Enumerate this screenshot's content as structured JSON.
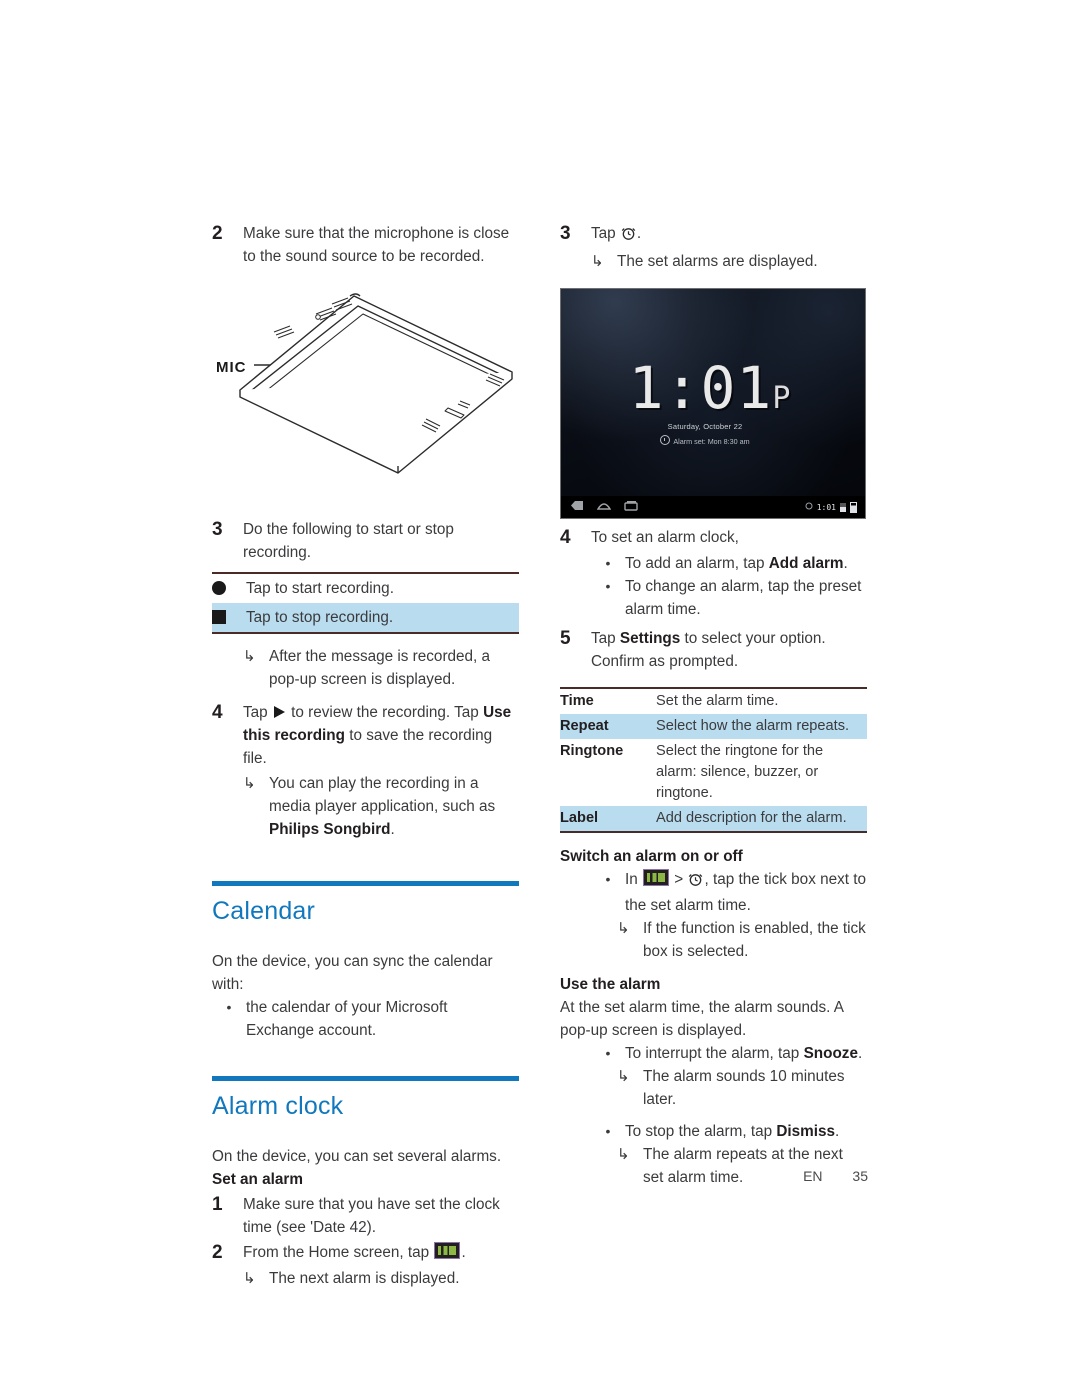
{
  "page": {
    "language_code": "EN",
    "page_number": "35"
  },
  "colors": {
    "heading_blue": "#1178bd",
    "row_highlight": "#b9dcef",
    "rule_dark": "#4a2b27",
    "body_text": "#3b3b3d"
  },
  "left_column": {
    "step2": {
      "number": "2",
      "text": "Make sure that the microphone is close to the sound source to be recorded."
    },
    "figure": {
      "label": "MIC",
      "caption_alt": "tablet illustration with microphone callout"
    },
    "step3": {
      "number": "3",
      "text": "Do the following to start or stop recording."
    },
    "record_table": {
      "rows": [
        {
          "icon": "record-circle-icon",
          "text": "Tap to start recording.",
          "highlight": false
        },
        {
          "icon": "stop-square-icon",
          "text": "Tap to stop recording.",
          "highlight": true
        }
      ]
    },
    "step3_result": "After the message is recorded, a pop-up screen is displayed.",
    "step4": {
      "number": "4",
      "text_before": "Tap",
      "icon": "play-icon",
      "text_middle": "to review the recording. Tap",
      "bold1": "Use this recording",
      "text_after": "to save the recording file."
    },
    "step4_result": {
      "text_before": "You can play the recording in a media player application, such as",
      "bold": "Philips Songbird",
      "text_after": "."
    },
    "calendar_section": {
      "title": "Calendar",
      "intro": "On the device, you can sync the calendar with:",
      "bullets": [
        "the calendar of your Microsoft Exchange account."
      ]
    },
    "alarm_section": {
      "title": "Alarm clock",
      "intro": "On the device, you can set several alarms.",
      "subhead": "Set an alarm",
      "step1": {
        "number": "1",
        "text": "Make sure that you have set the clock time (see 'Date 42)."
      },
      "step2": {
        "number": "2",
        "text_before": "From the Home screen, tap",
        "icon": "clock-app-icon",
        "text_after": "."
      },
      "step2_result": "The next alarm is displayed."
    }
  },
  "right_column": {
    "step3": {
      "number": "3",
      "text_before": "Tap",
      "icon": "alarm-clock-icon",
      "text_after": ".",
      "result": "The set alarms are displayed."
    },
    "screenshot": {
      "name": "android-clock-screenshot",
      "time": "1:01",
      "ampm": "P",
      "date": "Saturday, October 22",
      "alarm_status": "Alarm set: Mon 8:30 am",
      "statusbar_time": "1:01",
      "nav_icons": [
        "back-icon",
        "home-icon",
        "recents-icon"
      ],
      "status_icons": [
        "sync-icon",
        "wifi-icon",
        "battery-icon"
      ]
    },
    "step4": {
      "number": "4",
      "text": "To set an alarm clock,",
      "bullets": [
        {
          "text_before": "To add an alarm, tap",
          "bold": "Add alarm",
          "text_after": "."
        },
        {
          "text_before": "To change an alarm, tap the preset alarm time.",
          "bold": "",
          "text_after": ""
        }
      ]
    },
    "step5": {
      "number": "5",
      "text_before": "Tap",
      "bold": "Settings",
      "text_after": "to select your option. Confirm as prompted."
    },
    "settings_table": {
      "rows": [
        {
          "label": "Time",
          "desc": "Set the alarm time.",
          "highlight": false
        },
        {
          "label": "Repeat",
          "desc": "Select how the alarm repeats.",
          "highlight": true
        },
        {
          "label": "Ringtone",
          "desc": "Select the ringtone for the alarm: silence, buzzer, or ringtone.",
          "highlight": false
        },
        {
          "label": "Label",
          "desc": "Add description for the alarm.",
          "highlight": true
        }
      ]
    },
    "switch_section": {
      "subhead": "Switch an alarm on or off",
      "bullet_before": "In",
      "icon1": "clock-app-icon",
      "separator": ">",
      "icon2": "alarm-clock-icon",
      "bullet_after": ", tap the tick box next to the set alarm time.",
      "result": "If the function is enabled, the tick box is selected."
    },
    "use_section": {
      "subhead": "Use the alarm",
      "intro": "At the set alarm time, the alarm sounds. A pop-up screen is displayed.",
      "items": [
        {
          "text_before": "To interrupt the alarm, tap",
          "bold": "Snooze",
          "text_after": ".",
          "result": "The alarm sounds 10 minutes later."
        },
        {
          "text_before": "To stop the alarm, tap",
          "bold": "Dismiss",
          "text_after": ".",
          "result": "The alarm repeats at the next set alarm time."
        }
      ]
    }
  }
}
